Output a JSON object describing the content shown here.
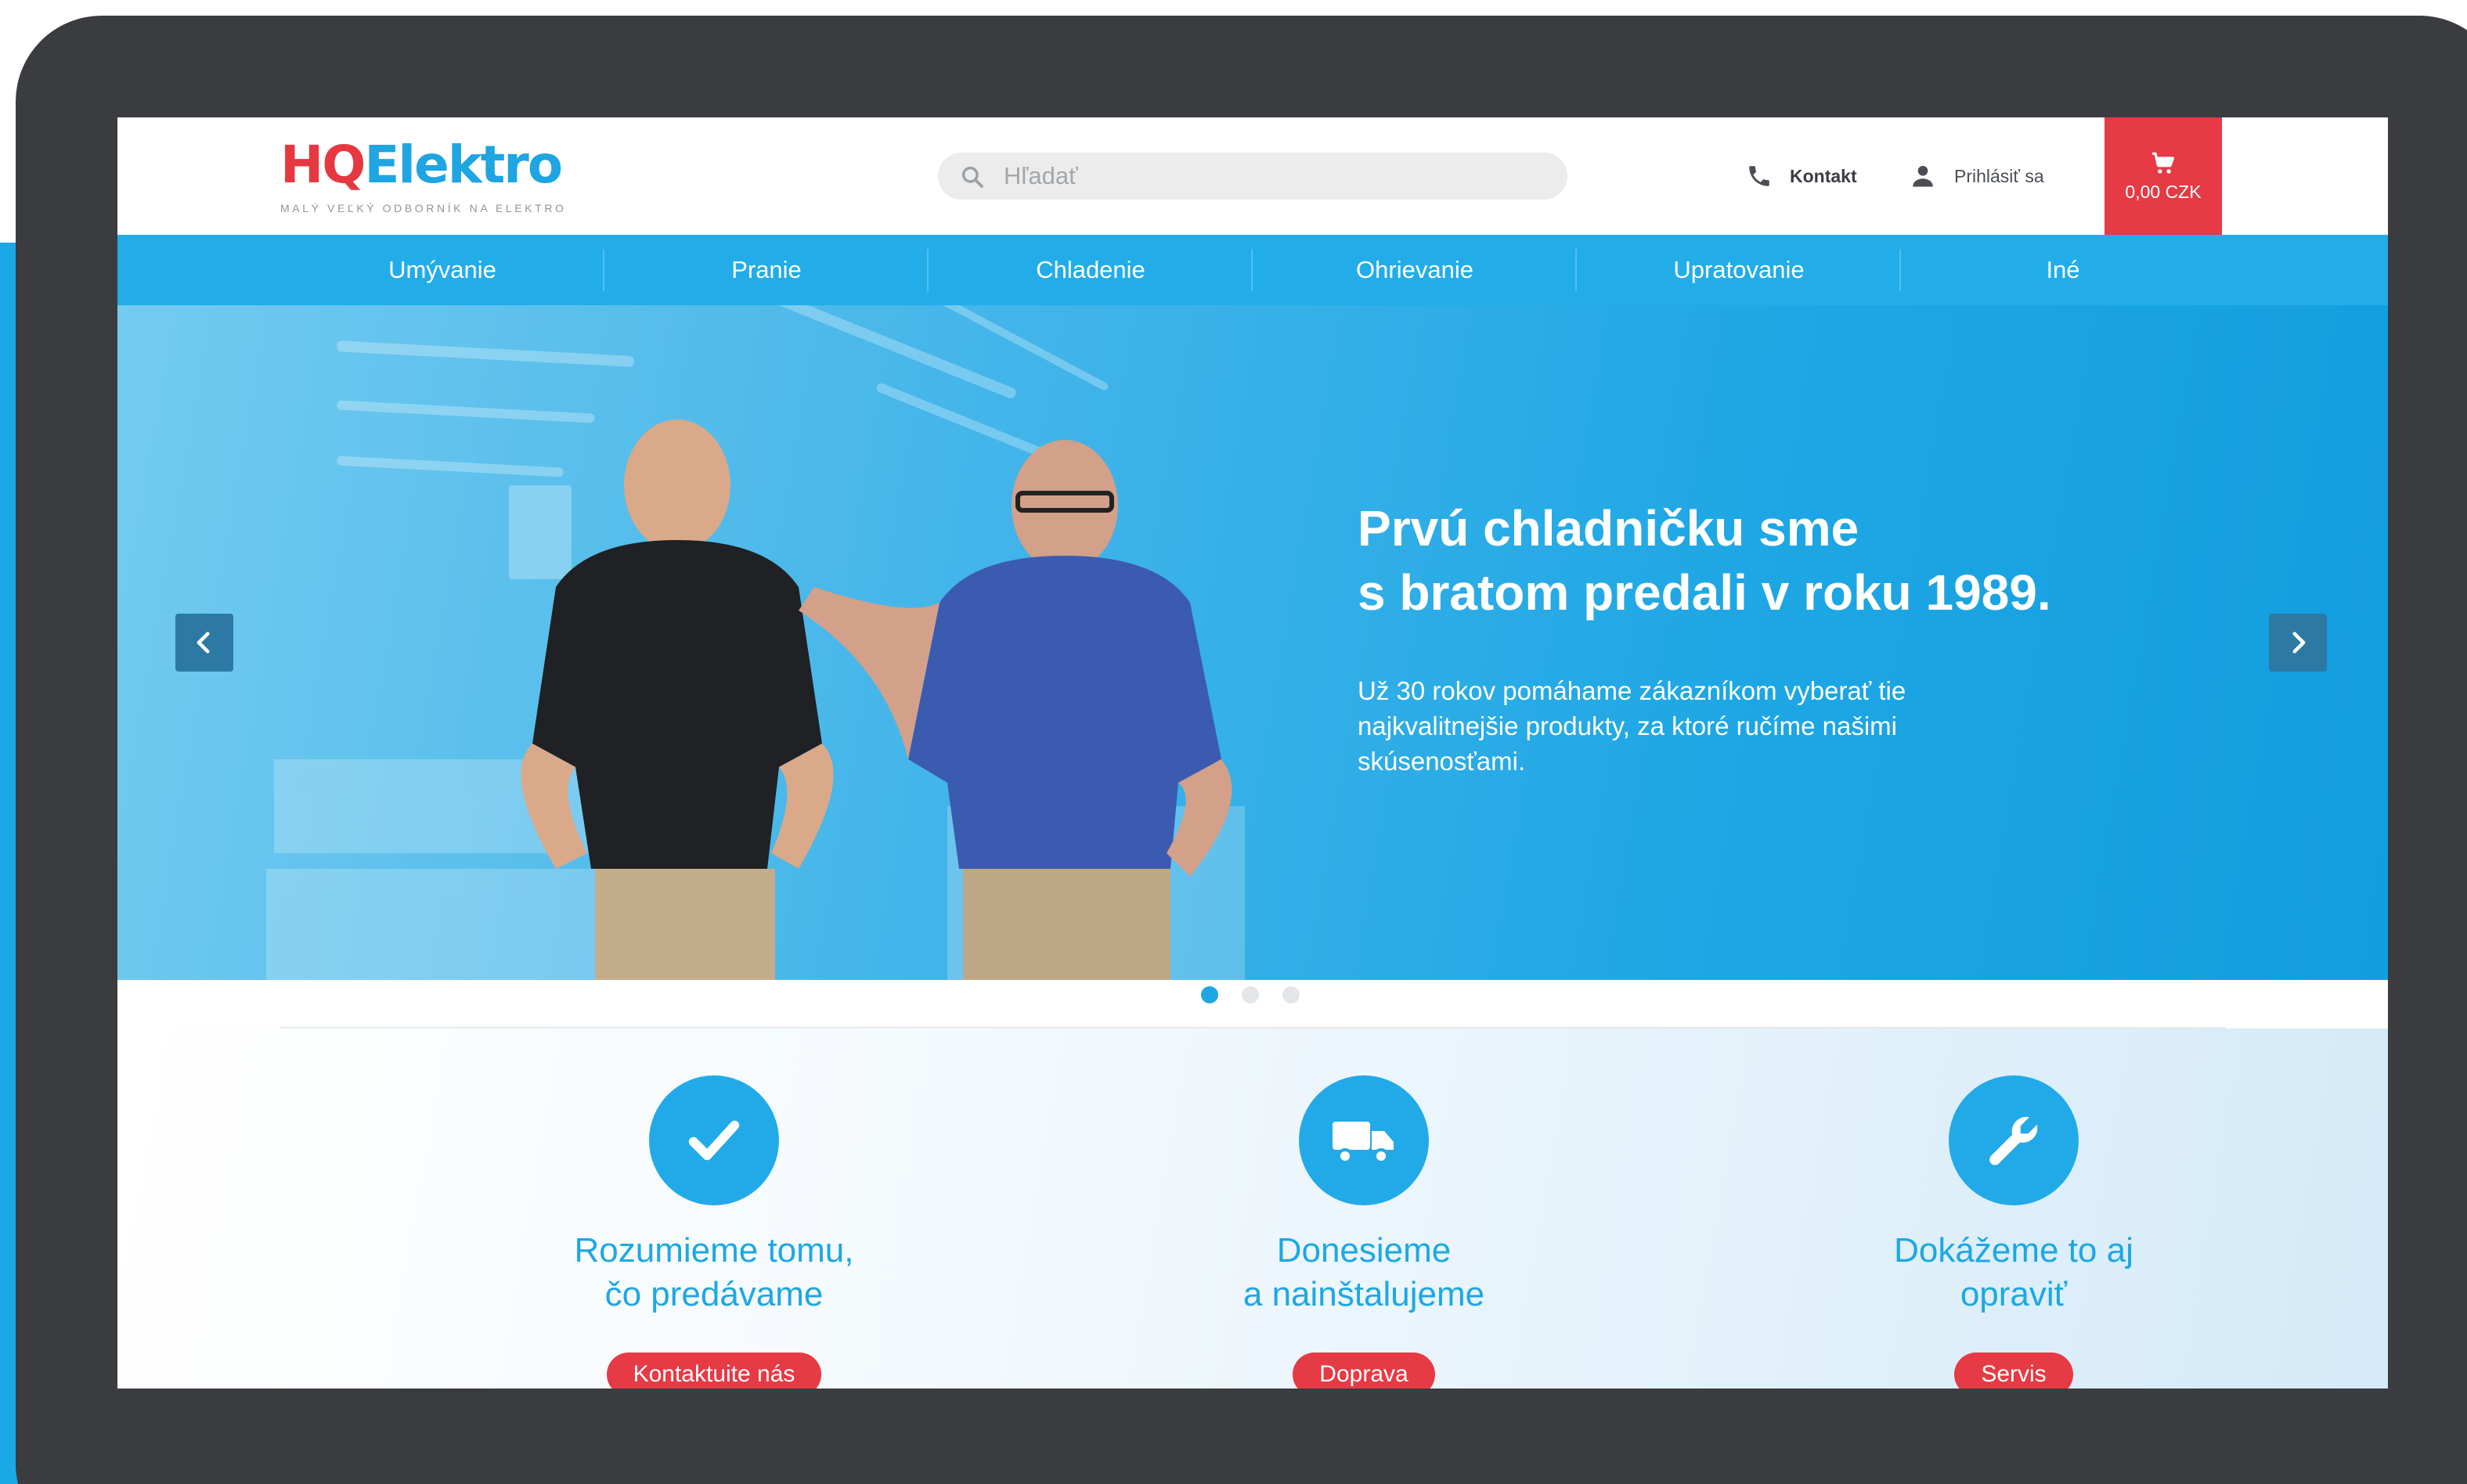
{
  "logo": {
    "part1": "HQ",
    "part2": "Elektro",
    "tagline": "MALÝ VEĽKÝ ODBORNÍK NA ELEKTRO"
  },
  "search": {
    "placeholder": "Hľadať",
    "value": ""
  },
  "header": {
    "contact_label": "Kontakt",
    "login_label": "Prihlásiť sa",
    "cart_total": "0,00 CZK"
  },
  "nav": {
    "items": [
      {
        "label": "Umývanie"
      },
      {
        "label": "Pranie"
      },
      {
        "label": "Chladenie"
      },
      {
        "label": "Ohrievanie"
      },
      {
        "label": "Upratovanie"
      },
      {
        "label": "Iné"
      }
    ]
  },
  "hero": {
    "title_line1": "Prvú chladničku sme",
    "title_line2": "s bratom predali v roku 1989.",
    "text": "Už 30 rokov pomáhame zákazníkom vyberať tie najkvalitnejšie produkty, za ktoré ručíme našimi skúsenosťami.",
    "slide_count": 3,
    "active_slide": 1
  },
  "features": [
    {
      "icon": "checkmark-icon",
      "title_line1": "Rozumieme tomu,",
      "title_line2": "čo predávame",
      "button": "Kontaktuite nás"
    },
    {
      "icon": "delivery-truck-icon",
      "title_line1": "Donesieme",
      "title_line2": "a nainštalujeme",
      "button": "Doprava"
    },
    {
      "icon": "wrench-icon",
      "title_line1": "Dokážeme to aj",
      "title_line2": "opraviť",
      "button": "Servis"
    }
  ],
  "colors": {
    "brand_red": "#e63a44",
    "brand_blue": "#1ea7e4",
    "device_frame": "#3a3c40"
  }
}
